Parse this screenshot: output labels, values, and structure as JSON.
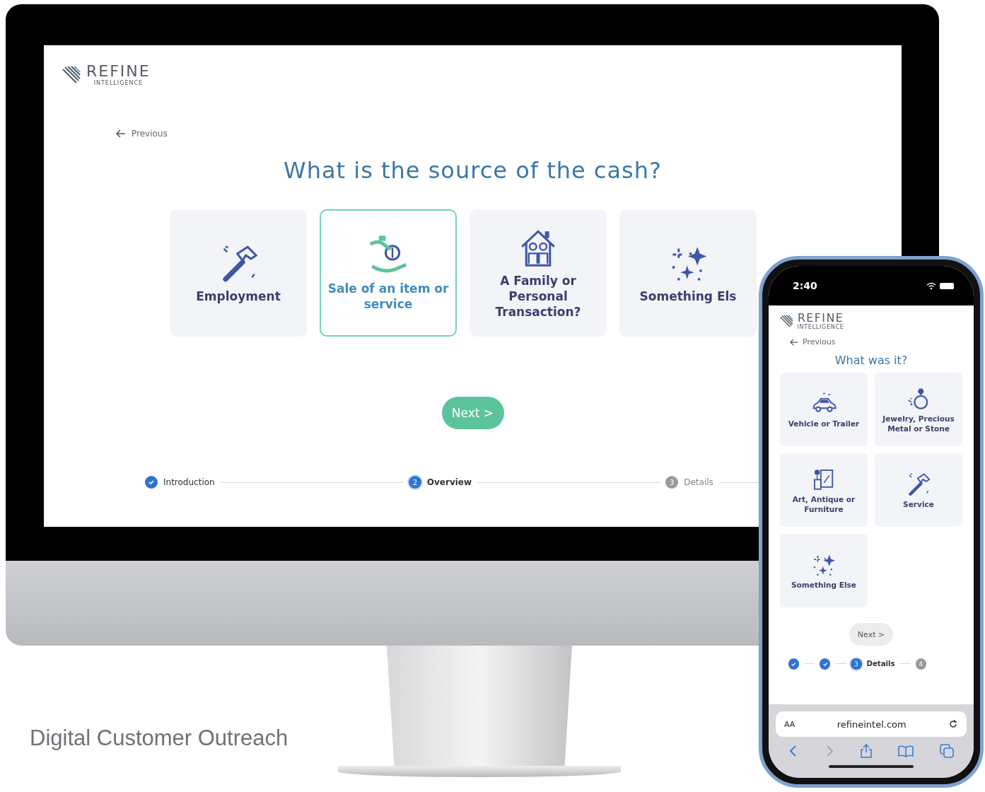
{
  "desktop": {
    "logo": {
      "name": "REFINE",
      "tagline": "INTELLIGENCE"
    },
    "back_link": "Previous",
    "question": "What is the source of the cash?",
    "options": [
      {
        "label": "Employment",
        "kind": "hammer",
        "selected": false
      },
      {
        "label": "Sale of an item or service",
        "kind": "hand-coin",
        "selected": true
      },
      {
        "label": "A Family or Personal Transaction?",
        "kind": "house",
        "selected": false
      },
      {
        "label": "Something Els",
        "kind": "sparkles",
        "selected": false
      }
    ],
    "next_button": "Next >",
    "steps": [
      {
        "label": "Introduction",
        "completed": true,
        "current": false
      },
      {
        "label": "Overview",
        "number": "2",
        "completed": false,
        "current": true
      },
      {
        "label": "Details",
        "number": "3",
        "completed": false,
        "current": false
      }
    ]
  },
  "phone": {
    "time": "2:40",
    "logo": {
      "name": "REFINE",
      "tagline": "INTELLIGENCE"
    },
    "back_link": "Previous",
    "question": "What was it?",
    "options": [
      {
        "label": "Vehicle or Trailer",
        "kind": "car",
        "selected": false
      },
      {
        "label": "Jewelry, Precious Metal or Stone",
        "kind": "ring",
        "selected": false
      },
      {
        "label": "Art, Antique or Furniture",
        "kind": "art",
        "selected": false
      },
      {
        "label": "Service",
        "kind": "hammer",
        "selected": false
      },
      {
        "label": "Something Else",
        "kind": "sparkles",
        "selected": false
      }
    ],
    "next_button": "Next >",
    "steps": [
      {
        "completed": true,
        "current": false
      },
      {
        "completed": true,
        "current": false
      },
      {
        "label": "Details",
        "number": "3",
        "completed": false,
        "current": true
      },
      {
        "number": "4",
        "completed": false,
        "current": false
      }
    ],
    "browser": {
      "text_size": "AA",
      "url": "refineintel.com"
    }
  },
  "caption": "Digital Customer Outreach"
}
